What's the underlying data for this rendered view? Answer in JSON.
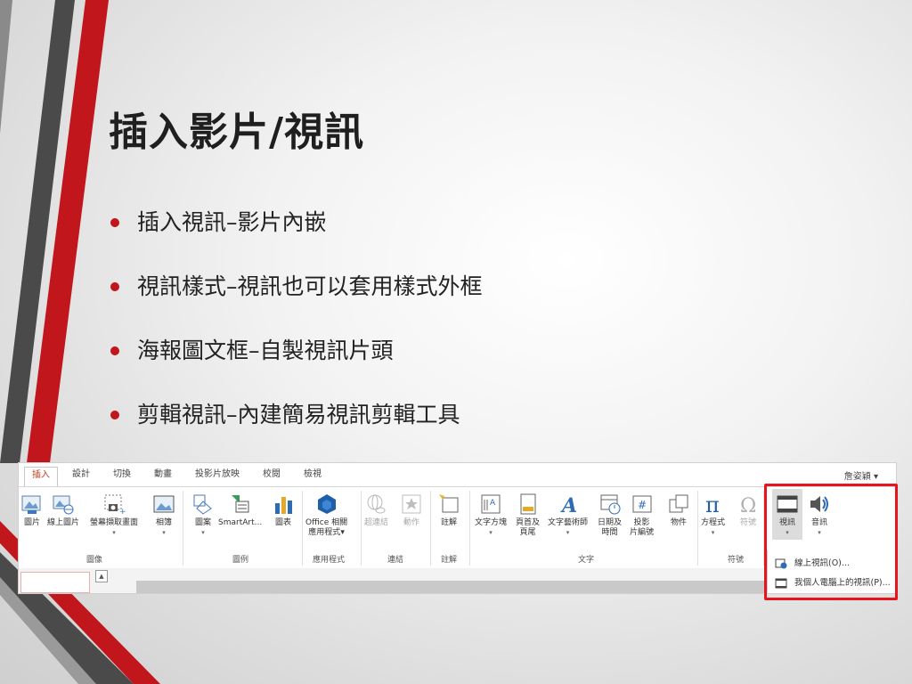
{
  "slide": {
    "title": "插入影片/視訊",
    "bullets": [
      "插入視訊–影片內嵌",
      "視訊樣式–視訊也可以套用樣式外框",
      "海報圖文框–自製視訊片頭",
      "剪輯視訊–內建簡易視訊剪輯工具"
    ],
    "accent_color": "#c0161c"
  },
  "ribbon": {
    "tabs": [
      "插入",
      "設計",
      "切換",
      "動畫",
      "投影片放映",
      "校閱",
      "檢視"
    ],
    "active_tab": "插入",
    "user_name": "詹姿穎",
    "groups": {
      "images": "圖像",
      "illustrations": "圖例",
      "apps": "應用程式",
      "links": "連結",
      "comments": "註解",
      "text": "文字",
      "symbols": "符號"
    },
    "commands": {
      "picture": "圖片",
      "online_picture": "線上圖片",
      "screenshot": "螢幕擷取畫面",
      "album": "相簿",
      "shapes": "圖案",
      "smartart": "SmartArt...",
      "chart": "圖表",
      "office_apps_line1": "Office 相關",
      "office_apps_line2": "應用程式",
      "hyperlink": "超連結",
      "action": "動作",
      "comment": "註解",
      "textbox": "文字方塊",
      "header_line1": "頁首及",
      "header_line2": "頁尾",
      "wordart": "文字藝術師",
      "datetime_line1": "日期及",
      "datetime_line2": "時間",
      "slide_number_line1": "投影",
      "slide_number_line2": "片編號",
      "object": "物件",
      "equation": "方程式",
      "symbol": "符號",
      "video": "視訊",
      "audio": "音訊"
    },
    "video_menu": {
      "online_video": "線上視訊(O)...",
      "pc_video": "我個人電腦上的視訊(P)..."
    }
  }
}
